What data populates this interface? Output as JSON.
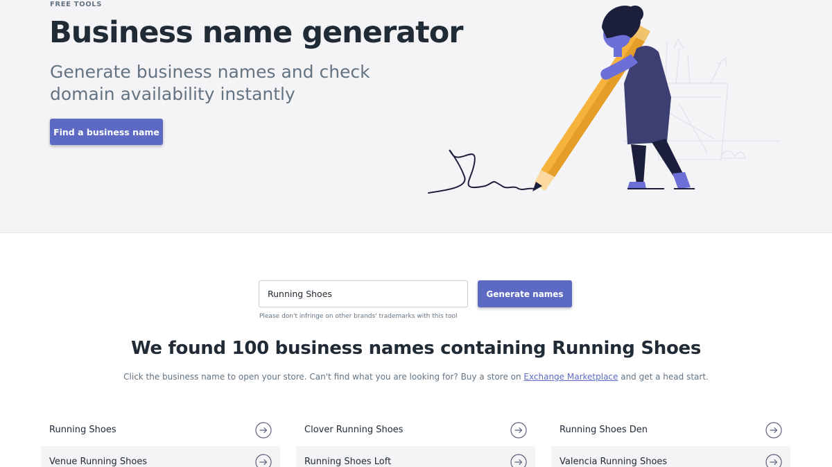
{
  "hero": {
    "eyebrow": "FREE TOOLS",
    "title": "Business name generator",
    "subtitle": "Generate business names and check domain availability instantly",
    "cta_label": "Find a business name"
  },
  "search": {
    "value": "Running Shoes",
    "button_label": "Generate names",
    "hint": "Please don't infringe on other brands' trademarks with this tool"
  },
  "results": {
    "title": "We found 100 business names containing Running Shoes",
    "desc_before": "Click the business name to open your store. Can't find what you are looking for? Buy a store on ",
    "desc_link": "Exchange Marketplace",
    "desc_after": " and get a head start.",
    "names": [
      "Running Shoes",
      "Clover Running Shoes",
      "Running Shoes Den",
      "Venue Running Shoes",
      "Running Shoes Loft",
      "Valencia Running Shoes"
    ]
  },
  "colors": {
    "accent": "#5c6ac4",
    "hero_bg": "#f4f4f6",
    "text_dark": "#212b36",
    "text_muted": "#637381"
  },
  "icons": {
    "card_arrow": "arrow-right-circle-icon",
    "illustration": "person-with-pencil-illustration"
  }
}
